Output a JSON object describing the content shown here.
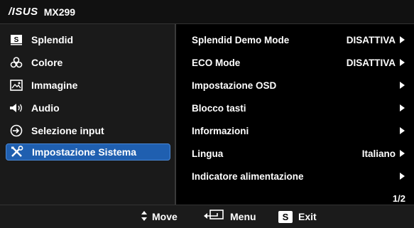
{
  "header": {
    "brand": "/ISUS",
    "model": "MX299"
  },
  "left_menu": [
    {
      "label": "Splendid",
      "icon": "splendid-icon"
    },
    {
      "label": "Colore",
      "icon": "colore-icon"
    },
    {
      "label": "Immagine",
      "icon": "immagine-icon"
    },
    {
      "label": "Audio",
      "icon": "audio-icon"
    },
    {
      "label": "Selezione input",
      "icon": "input-icon"
    },
    {
      "label": "Impostazione Sistema",
      "icon": "system-icon",
      "selected": true
    }
  ],
  "settings": [
    {
      "label": "Splendid Demo Mode",
      "value": "DISATTIVA"
    },
    {
      "label": "ECO Mode",
      "value": "DISATTIVA"
    },
    {
      "label": "Impostazione OSD",
      "value": ""
    },
    {
      "label": "Blocco tasti",
      "value": ""
    },
    {
      "label": "Informazioni",
      "value": ""
    },
    {
      "label": "Lingua",
      "value": "Italiano"
    },
    {
      "label": "Indicatore alimentazione",
      "value": ""
    }
  ],
  "page_indicator": "1/2",
  "footer": {
    "move": "Move",
    "menu": "Menu",
    "exit": "Exit",
    "s_key": "S"
  },
  "colors": {
    "selected_bg": "#1f5fb0"
  }
}
